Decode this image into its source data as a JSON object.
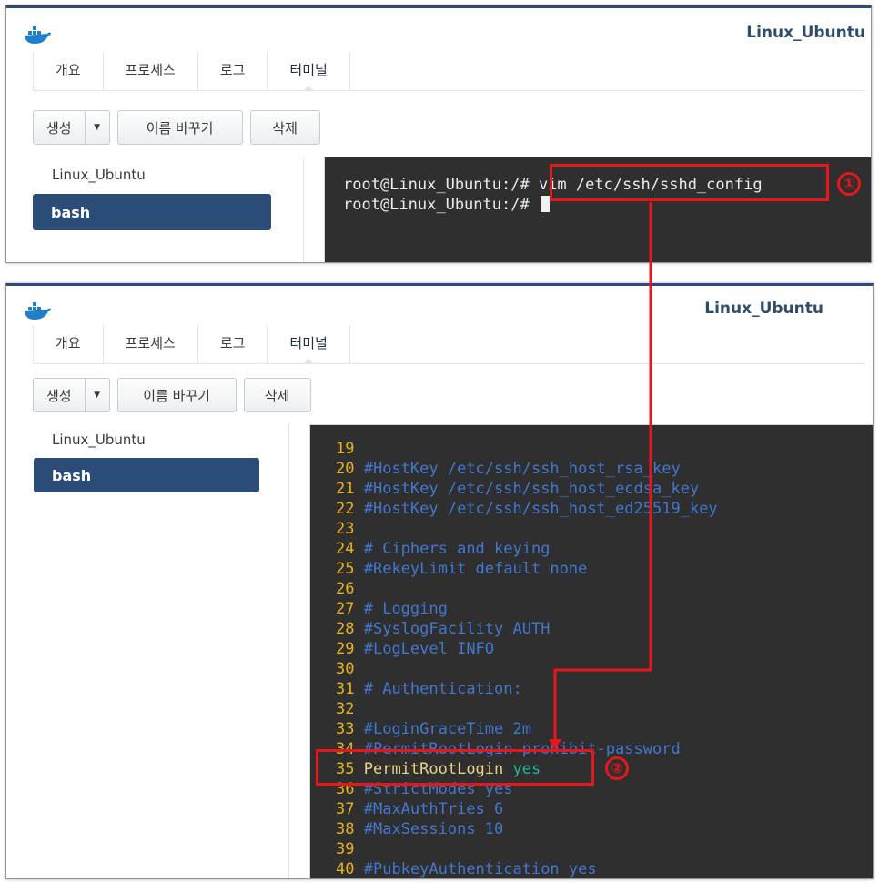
{
  "panel1": {
    "title": "Linux_Ubuntu",
    "tabs": [
      {
        "label": "개요",
        "active": false
      },
      {
        "label": "프로세스",
        "active": false
      },
      {
        "label": "로그",
        "active": false
      },
      {
        "label": "터미널",
        "active": true
      }
    ],
    "buttons": {
      "create": "생성",
      "rename": "이름 바꾸기",
      "delete": "삭제"
    },
    "sidebar": {
      "container": "Linux_Ubuntu",
      "selected": "bash"
    },
    "terminal": {
      "lines": [
        {
          "prompt": "root@Linux_Ubuntu:/# ",
          "cmd": "vim /etc/ssh/sshd_config"
        },
        {
          "prompt": "root@Linux_Ubuntu:/# ",
          "cmd": ""
        }
      ]
    },
    "badge": "①"
  },
  "panel2": {
    "title": "Linux_Ubuntu",
    "tabs": [
      {
        "label": "개요",
        "active": false
      },
      {
        "label": "프로세스",
        "active": false
      },
      {
        "label": "로그",
        "active": false
      },
      {
        "label": "터미널",
        "active": true
      }
    ],
    "buttons": {
      "create": "생성",
      "rename": "이름 바꾸기",
      "delete": "삭제"
    },
    "sidebar": {
      "container": "Linux_Ubuntu",
      "selected": "bash"
    },
    "config": [
      {
        "n": "19",
        "text": "",
        "kind": "blank"
      },
      {
        "n": "20",
        "text": "#HostKey /etc/ssh/ssh_host_rsa_key",
        "kind": "comment"
      },
      {
        "n": "21",
        "text": "#HostKey /etc/ssh/ssh_host_ecdsa_key",
        "kind": "comment"
      },
      {
        "n": "22",
        "text": "#HostKey /etc/ssh/ssh_host_ed25519_key",
        "kind": "comment"
      },
      {
        "n": "23",
        "text": "",
        "kind": "blank"
      },
      {
        "n": "24",
        "text": "# Ciphers and keying",
        "kind": "comment"
      },
      {
        "n": "25",
        "text": "#RekeyLimit default none",
        "kind": "comment"
      },
      {
        "n": "26",
        "text": "",
        "kind": "blank"
      },
      {
        "n": "27",
        "text": "# Logging",
        "kind": "comment"
      },
      {
        "n": "28",
        "text": "#SyslogFacility AUTH",
        "kind": "comment"
      },
      {
        "n": "29",
        "text": "#LogLevel INFO",
        "kind": "comment"
      },
      {
        "n": "30",
        "text": "",
        "kind": "blank"
      },
      {
        "n": "31",
        "text": "# Authentication:",
        "kind": "comment"
      },
      {
        "n": "32",
        "text": "",
        "kind": "blank"
      },
      {
        "n": "33",
        "text": "#LoginGraceTime 2m",
        "kind": "comment"
      },
      {
        "n": "34",
        "text": "#PermitRootLogin prohibit-password",
        "kind": "comment"
      },
      {
        "n": "35",
        "text": "PermitRootLogin",
        "value": "yes",
        "kind": "setting"
      },
      {
        "n": "36",
        "text": "#StrictModes yes",
        "kind": "comment"
      },
      {
        "n": "37",
        "text": "#MaxAuthTries 6",
        "kind": "comment"
      },
      {
        "n": "38",
        "text": "#MaxSessions 10",
        "kind": "comment"
      },
      {
        "n": "39",
        "text": "",
        "kind": "blank"
      },
      {
        "n": "40",
        "text": "#PubkeyAuthentication yes",
        "kind": "comment"
      }
    ],
    "badge": "②"
  },
  "colors": {
    "accent": "#2a4c77",
    "highlight": "#e8161b",
    "terminal_bg": "#2f2f2f",
    "line_number": "#e6b31c",
    "comment": "#4277d0",
    "setting": "#e8d38a",
    "value": "#1fb7a0"
  },
  "icons": {
    "app_logo": "docker-whale-icon",
    "dropdown": "caret-down-icon"
  }
}
